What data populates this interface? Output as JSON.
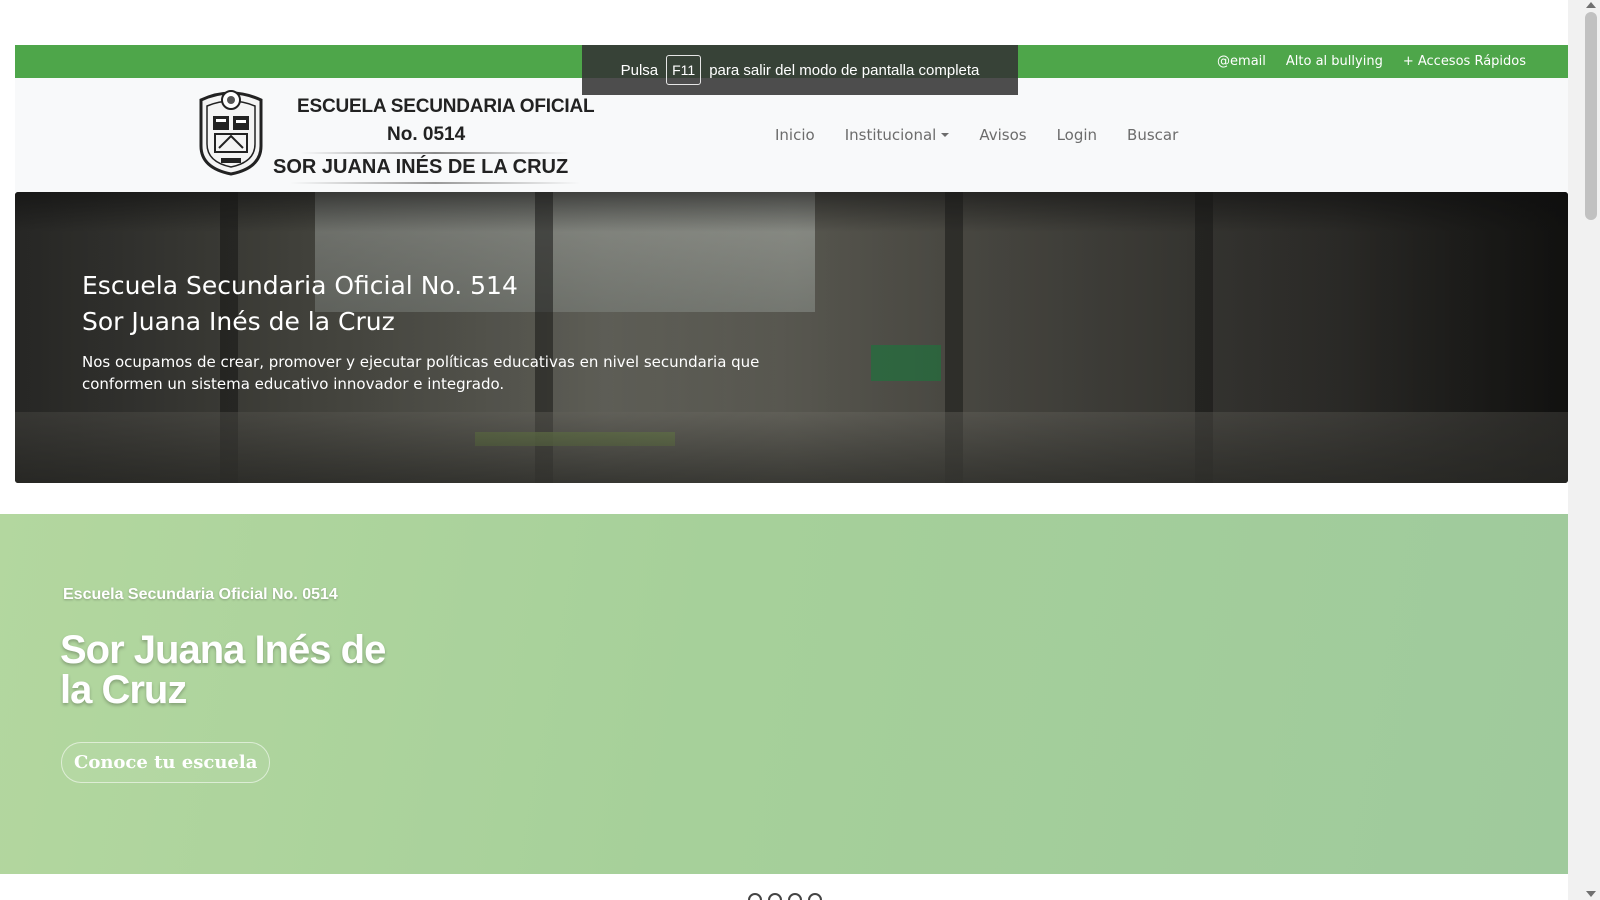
{
  "topbar": {
    "links": [
      "@email",
      "Alto al bullying",
      "+ Accesos Rápidos"
    ],
    "color": "#4ea64a"
  },
  "fullscreen_toast": {
    "before": "Pulsa",
    "key": "F11",
    "after": "para salir del modo de pantalla completa"
  },
  "logo": {
    "line1": "ESCUELA SECUNDARIA OFICIAL",
    "line2": "No. 0514",
    "line3": "SOR JUANA INÉS DE LA CRUZ",
    "seal_icon": "coat-of-arms-icon"
  },
  "nav": {
    "items": [
      "Inicio",
      "Institucional",
      "Avisos",
      "Login",
      "Buscar"
    ]
  },
  "hero": {
    "title_line1": "Escuela Secundaria Oficial No. 514",
    "title_line2": "Sor Juana Inés de la Cruz",
    "text": "Nos ocupamos de crear, promover y ejecutar políticas educativas en nivel secundaria que conformen un sistema educativo innovador e integrado."
  },
  "green_section": {
    "subtitle": "Escuela Secundaria Oficial No. 0514",
    "title": "Sor Juana Inés de la Cruz",
    "button": "Conoce tu escuela",
    "color": "#a6d09a"
  }
}
